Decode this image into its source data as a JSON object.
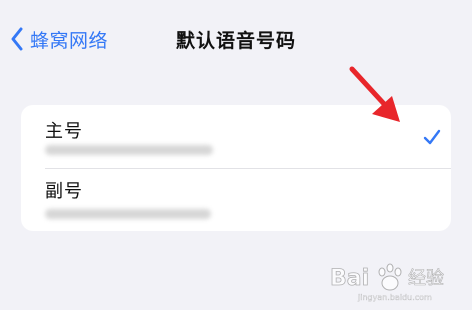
{
  "nav": {
    "back_label": "蜂窝网络",
    "title": "默认语音号码"
  },
  "lines": [
    {
      "label": "主号",
      "detail_hidden": true,
      "selected": true
    },
    {
      "label": "副号",
      "detail_hidden": true,
      "selected": false
    }
  ],
  "watermark": {
    "text": "Bai 经验"
  },
  "colors": {
    "accent": "#3478f6",
    "background": "#f2f2f7",
    "annotation": "#e8262b"
  },
  "icons": {
    "back": "chevron-left-icon",
    "selected": "checkmark-icon",
    "annotation": "red-arrow-icon"
  }
}
